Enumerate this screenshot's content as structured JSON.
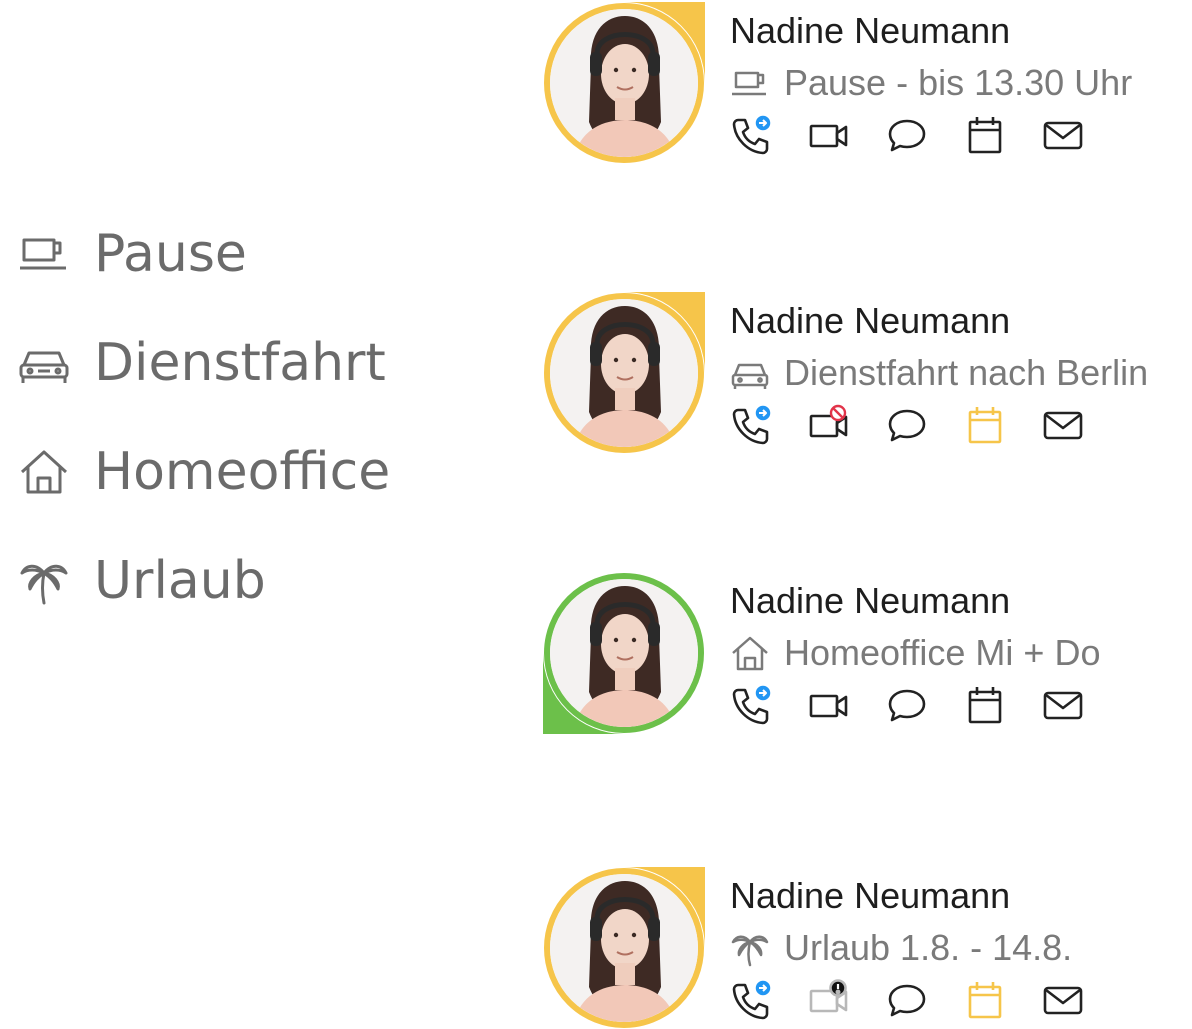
{
  "legend": [
    {
      "label": "Pause",
      "icon": "coffee-cup-icon"
    },
    {
      "label": "Dienstfahrt",
      "icon": "car-icon"
    },
    {
      "label": "Homeoffice",
      "icon": "home-icon"
    },
    {
      "label": "Urlaub",
      "icon": "palm-tree-icon"
    }
  ],
  "contacts": [
    {
      "name": "Nadine Neumann",
      "status_text": "Pause - bis 13.30 Uhr",
      "status_icon": "coffee-cup-icon",
      "ring_color": "#f6c54a",
      "corner": "top-right",
      "video_state": "normal",
      "calendar_color": "#222222"
    },
    {
      "name": "Nadine Neumann",
      "status_text": "Dienstfahrt nach Berlin",
      "status_icon": "car-icon",
      "ring_color": "#f6c54a",
      "corner": "top-right",
      "video_state": "blocked",
      "calendar_color": "#f6c54a"
    },
    {
      "name": "Nadine Neumann",
      "status_text": "Homeoffice Mi + Do",
      "status_icon": "home-icon",
      "ring_color": "#6cc04a",
      "corner": "bottom-left",
      "video_state": "normal",
      "calendar_color": "#222222"
    },
    {
      "name": "Nadine Neumann",
      "status_text": "Urlaub 1.8. - 14.8.",
      "status_icon": "palm-tree-icon",
      "ring_color": "#f6c54a",
      "corner": "top-right",
      "video_state": "warning",
      "calendar_color": "#f6c54a"
    }
  ],
  "colors": {
    "text_primary": "#1e1e1e",
    "text_secondary": "#7a7a7a",
    "presence_away": "#f6c54a",
    "presence_available": "#6cc04a",
    "forward_badge": "#2196f3",
    "blocked_badge": "#e2344a"
  }
}
